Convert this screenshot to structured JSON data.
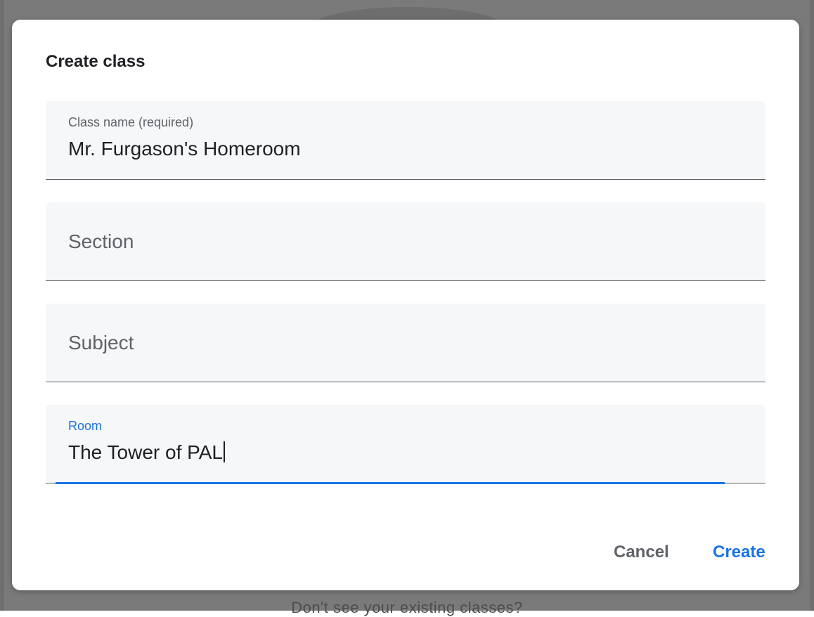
{
  "background": {
    "partial_text": "Don't see your existing classes?"
  },
  "dialog": {
    "title": "Create class",
    "fields": {
      "class_name": {
        "label": "Class name (required)",
        "value": "Mr. Furgason's Homeroom"
      },
      "section": {
        "placeholder": "Section",
        "value": ""
      },
      "subject": {
        "placeholder": "Subject",
        "value": ""
      },
      "room": {
        "label": "Room",
        "value": "The Tower of PAL",
        "focused": true
      }
    },
    "buttons": {
      "cancel": "Cancel",
      "create": "Create"
    }
  },
  "colors": {
    "accent": "#1a73e8",
    "field_bg": "#f5f7f9",
    "overlay": "#7a7a7a"
  }
}
